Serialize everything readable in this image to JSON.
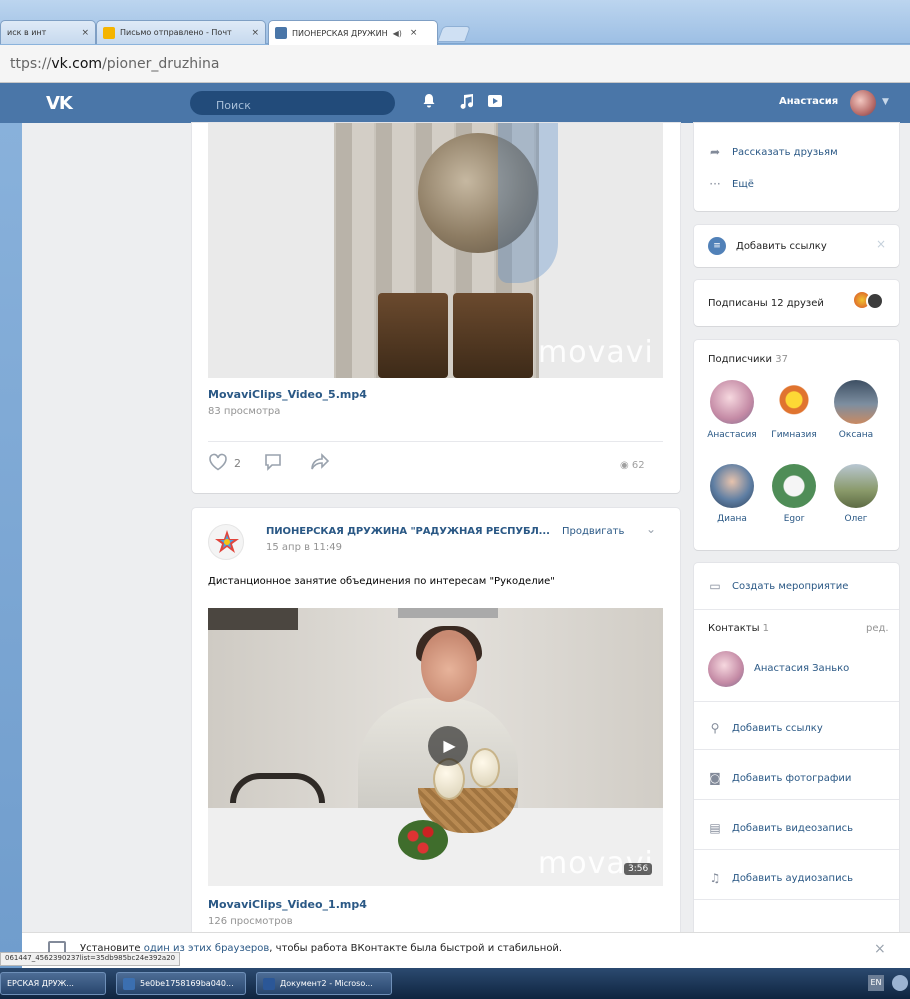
{
  "browser": {
    "tabs": [
      {
        "label": "иск в инт"
      },
      {
        "label": "Письмо отправлено - Почт"
      },
      {
        "label": "ПИОНЕРСКАЯ ДРУЖИН"
      }
    ],
    "tab_close": "×",
    "tab_audio": "◀)",
    "url_scheme": "ttps://",
    "url_domain": "vk.com",
    "url_path": "/pioner_druzhina"
  },
  "vk_header": {
    "logo": "VK",
    "search_placeholder": "Поиск",
    "user_name": "Анастасия"
  },
  "post1": {
    "watermark": "movavi",
    "video_title": "MovaviClips_Video_5.mp4",
    "video_views": "83 просмотра",
    "likes": "2",
    "view_count": "62"
  },
  "post2": {
    "group_name": "ПИОНЕРСКАЯ ДРУЖИНА \"РАДУЖНАЯ РЕСПУБЛ...",
    "date": "15 апр в 11:49",
    "promote": "Продвигать",
    "text": "Дистанционное занятие объединения по интересам \"Рукоделие\"",
    "watermark": "movavi",
    "duration": "3:56",
    "video_title": "MovaviClips_Video_1.mp4",
    "video_views": "126 просмотров"
  },
  "right_column": {
    "tell_friends": "Рассказать друзьям",
    "more": "Ещё",
    "add_link": "Добавить ссылку",
    "subscribed_friends": "Подписаны 12 друзей",
    "subscribers_label": "Подписчики",
    "subscribers_count": "37",
    "subscribers": [
      {
        "name": "Анастасия",
        "color": "#c48aa5"
      },
      {
        "name": "Гимназия",
        "color": "#e0742f"
      },
      {
        "name": "Оксана",
        "color": "#516a83"
      },
      {
        "name": "Диана",
        "color": "#5e7ea3"
      },
      {
        "name": "Egor",
        "color": "#4f8d57"
      },
      {
        "name": "Олег",
        "color": "#8a9a6a"
      }
    ],
    "create_event": "Создать мероприятие",
    "contacts_label": "Контакты",
    "contacts_count": "1",
    "contacts_edit": "ред.",
    "contact_name": "Анастасия Занько",
    "add_link2": "Добавить ссылку",
    "add_photos": "Добавить фотографии",
    "add_video": "Добавить видеозапись",
    "add_audio": "Добавить аудиозапись"
  },
  "banner": {
    "text_before": "Установите ",
    "link": "один из этих браузеров",
    "text_after": ", чтобы работа ВКонтакте была быстрой и стабильной.",
    "status_url": "061447_4562390237list=35db985bc24e392a20"
  },
  "taskbar": {
    "items": [
      {
        "label": "ЕРСКАЯ ДРУЖ..."
      },
      {
        "label": "5e0be1758169ba040..."
      },
      {
        "label": "Документ2 - Microso..."
      }
    ],
    "tray_label": "EN"
  }
}
